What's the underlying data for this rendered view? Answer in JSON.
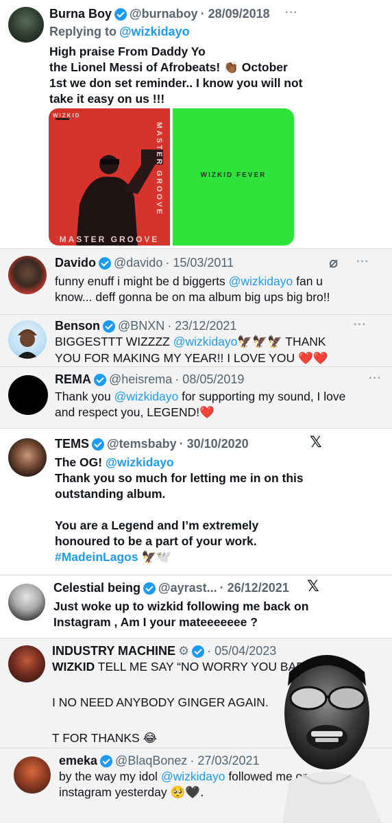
{
  "tweets": [
    {
      "name": "Burna Boy",
      "handle": "@burnaboy",
      "date": "· 28/09/2018",
      "reply_prefix": "Replying to",
      "reply_to": "@wizkidayo",
      "lines": [
        "High praise From Daddy Yo",
        "the Lionel Messi of Afrobeats! 👏🏾 October",
        "1st we don set reminder.. I know you will not",
        "take it easy on us !!!"
      ],
      "media": {
        "left_cover_title": "MASTER GROOVE",
        "left_cover_artist": "WIZKID",
        "right_cover_title": "WIZKID FEVER"
      },
      "more_icon": "more-dots-icon"
    },
    {
      "name": "Davido",
      "handle": "@davido",
      "date": "· 15/03/2011",
      "line1_pre": "funny enuff i might be d biggerts ",
      "mention": "@wizkidayo",
      "line1_post": " fan u",
      "line2": "know... deff gonna be on ma album big ups big bro!!"
    },
    {
      "name": "Benson",
      "handle": "@BNXN",
      "date": "· 23/12/2021",
      "line1_pre": "BIGGESTTT WIZZZZ ",
      "mention": "@wizkidayo",
      "line1_emoji": "🦅🦅🦅",
      "line1_post": " THANK",
      "line2": "YOU FOR MAKING MY YEAR!! I LOVE YOU",
      "line2_emoji": "❤️❤️"
    },
    {
      "name": "REMA",
      "handle": "@heisrema",
      "date": "· 08/05/2019",
      "line1_pre": "Thank you ",
      "mention": "@wizkidayo",
      "line1_post": " for supporting my sound, I love",
      "line2": "and respect you, LEGEND!",
      "line2_emoji": "❤️"
    },
    {
      "name": "TEMS",
      "handle": "@temsbaby",
      "date": "· 30/10/2020",
      "line1_pre": "The OG! ",
      "mention": "@wizkidayo",
      "line2": "Thank you so much for letting me in on this",
      "line3": "outstanding album.",
      "line4": "You are a Legend and I’m extremely",
      "line5": "honoured to be a part of your work.",
      "hashtag": "#MadeinLagos",
      "hashtag_emoji": "🦅🕊️",
      "x_logo": "𝕏"
    },
    {
      "name": "Celestial being",
      "handle": "@ayrast...",
      "date": "· 26/12/2021",
      "line1": "Just woke up to wizkid following me back on",
      "line2": "Instagram , Am I your mateeeeeee ?",
      "x_logo": "𝕏"
    },
    {
      "name": "INDUSTRY MACHINE",
      "handle": "· 05/04/2023",
      "line1_bold": "WIZKID",
      "line1": " TELL ME SAY “NO WORRY YOU BAD",
      "line2": "I NO NEED ANYBODY GINGER AGAIN.",
      "line3": "T FOR THANKS",
      "line3_emoji": "😂"
    },
    {
      "name": "emeka",
      "handle": "@BlaqBonez",
      "date": "· 27/03/2021",
      "line1_pre": "by the way my idol ",
      "mention": "@wizkidayo",
      "line1_post": " followed me on",
      "line2": "instagram yesterday",
      "line2_emoji": "🥺🖤."
    }
  ]
}
